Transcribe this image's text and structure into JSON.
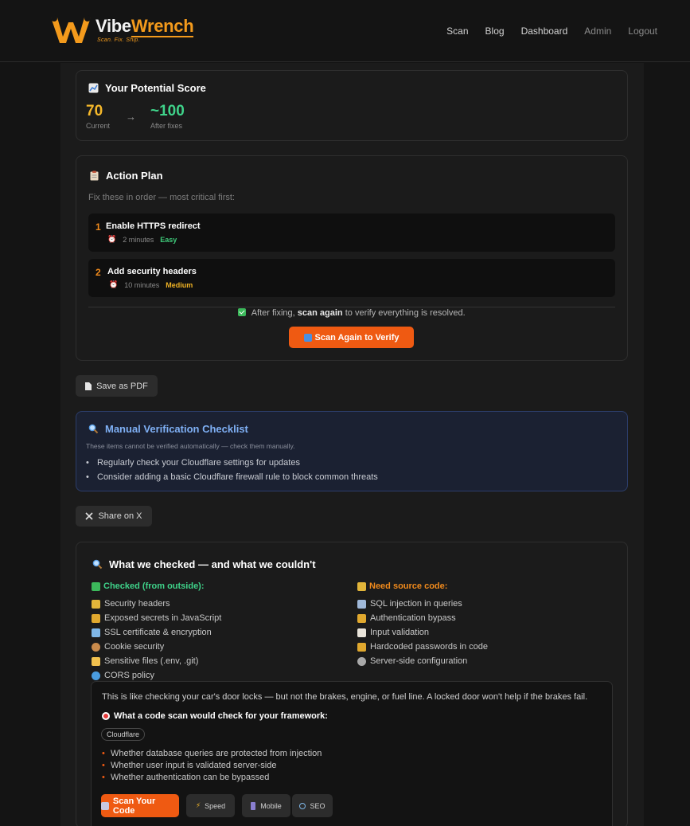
{
  "header": {
    "brand_part1": "Vibe",
    "brand_part2": "Wrench",
    "tagline": "Scan. Fix. Ship.",
    "nav": [
      "Scan",
      "Blog",
      "Dashboard",
      "Admin",
      "Logout"
    ]
  },
  "score": {
    "title": "Your Potential Score",
    "current_value": "70",
    "current_label": "Current",
    "arrow": "→",
    "after_value": "~100",
    "after_label": "After fixes"
  },
  "plan": {
    "title": "Action Plan",
    "subtitle": "Fix these in order — most critical first:",
    "steps": [
      {
        "num": "1",
        "title": "Enable HTTPS redirect",
        "time": "2 minutes",
        "difficulty": "Easy"
      },
      {
        "num": "2",
        "title": "Add security headers",
        "time": "10 minutes",
        "difficulty": "Medium"
      }
    ],
    "note_prefix": "After fixing,",
    "note_bold": "scan again",
    "note_suffix": "to verify everything is resolved.",
    "scan_again_label": "Scan Again to Verify"
  },
  "pdf_label": "Save as PDF",
  "manual": {
    "title": "Manual Verification Checklist",
    "subtitle": "These items cannot be verified automatically — check them manually.",
    "items": [
      "Regularly check your Cloudflare settings for updates",
      "Consider adding a basic Cloudflare firewall rule to block common threats"
    ]
  },
  "share_label": "Share on X",
  "checked": {
    "title": "What we checked — and what we couldn't",
    "outside_head": "Checked (from outside):",
    "outside_items": [
      "Security headers",
      "Exposed secrets in JavaScript",
      "SSL certificate & encryption",
      "Cookie security",
      "Sensitive files (.env, .git)",
      "CORS policy"
    ],
    "source_head": "Need source code:",
    "source_items": [
      "SQL injection in queries",
      "Authentication bypass",
      "Input validation",
      "Hardcoded passwords in code",
      "Server-side configuration"
    ],
    "analogy": "This is like checking your car's door locks — but not the brakes, engine, or fuel line. A locked door won't help if the brakes fail.",
    "framework_title": "What a code scan would check for your framework:",
    "framework_chip": "Cloudflare",
    "framework_items": [
      "Whether database queries are protected from injection",
      "Whether user input is validated server-side",
      "Whether authentication can be bypassed"
    ],
    "scan_code_label": "Scan Your Code",
    "tools": [
      "Speed",
      "Mobile",
      "SEO"
    ]
  },
  "colors": {
    "accent_orange": "#ef5a12",
    "score_current": "#f5b82a",
    "score_after": "#3fd38a",
    "checked_green": "#3fd38a",
    "source_orange": "#f08a1c"
  }
}
